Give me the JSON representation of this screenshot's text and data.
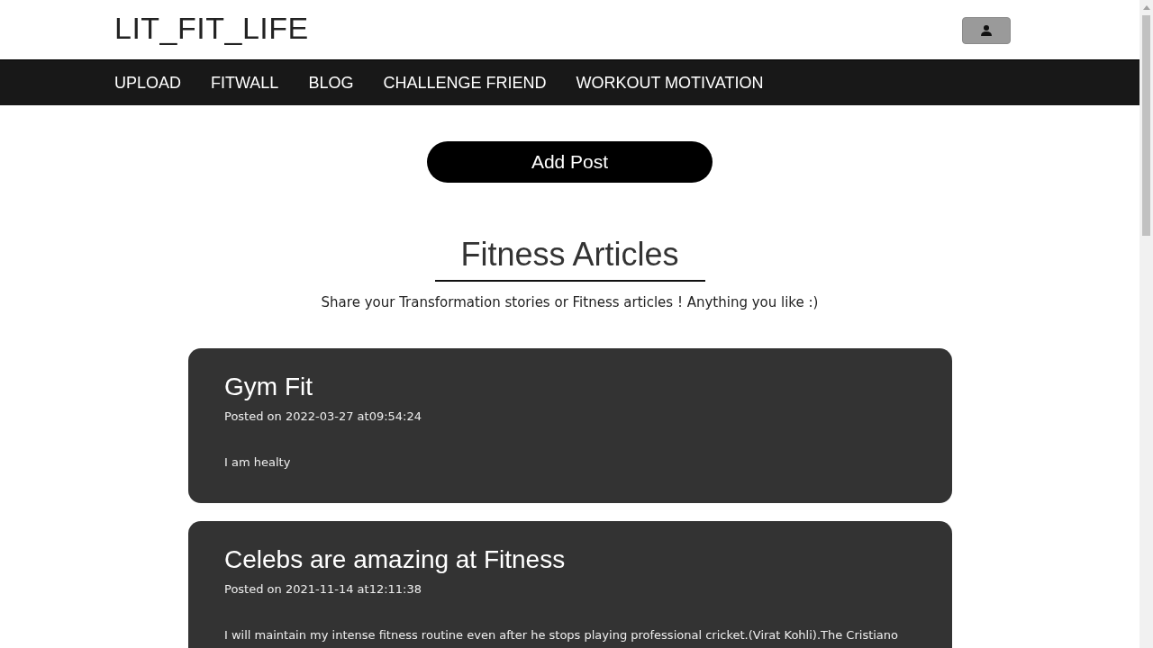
{
  "header": {
    "logo": "LIT_FIT_LIFE"
  },
  "nav": {
    "items": [
      {
        "label": "UPLOAD"
      },
      {
        "label": "FITWALL"
      },
      {
        "label": "BLOG"
      },
      {
        "label": "CHALLENGE FRIEND"
      },
      {
        "label": "WORKOUT MOTIVATION"
      }
    ]
  },
  "add_post_button": "Add Post",
  "section": {
    "title": "Fitness Articles",
    "subtitle": "Share your Transformation stories or Fitness articles ! Anything you like :)"
  },
  "posts": [
    {
      "title": "Gym Fit",
      "posted": "Posted on 2022-03-27 at09:54:24",
      "body": "I am healty"
    },
    {
      "title": "Celebs are amazing at Fitness",
      "posted": "Posted on 2021-11-14 at12:11:38",
      "body": "I will maintain my intense fitness routine even after he stops playing professional cricket.(Virat Kohli).The Cristiano"
    }
  ]
}
